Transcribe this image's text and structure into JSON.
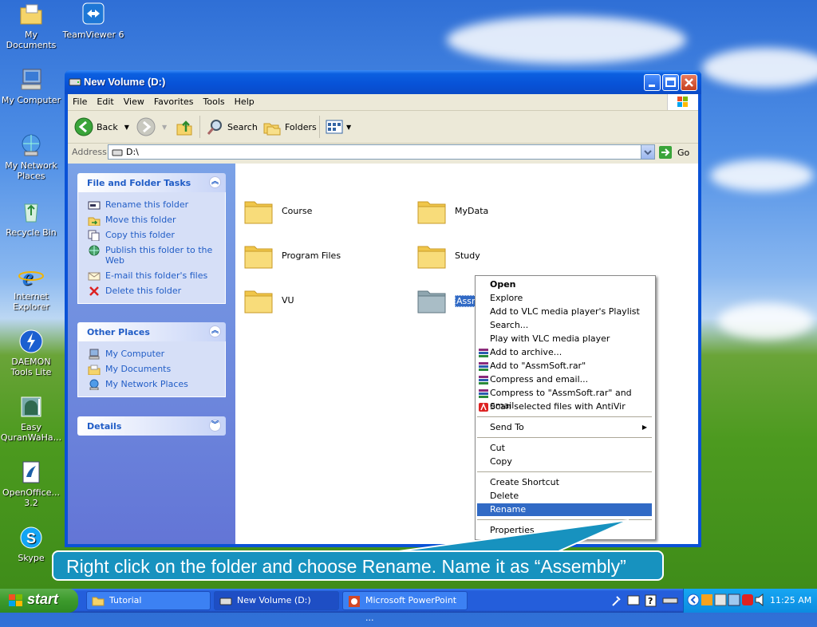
{
  "desktop": {
    "icons": [
      {
        "label": "My Documents"
      },
      {
        "label": "TeamViewer 6"
      },
      {
        "label": "My Computer"
      },
      {
        "label": "My Network Places"
      },
      {
        "label": "Recycle Bin"
      },
      {
        "label": "Internet Explorer"
      },
      {
        "label": "DAEMON Tools Lite"
      },
      {
        "label": "Easy QuranWaHa..."
      },
      {
        "label": "OpenOffice... 3.2"
      },
      {
        "label": "Skype"
      }
    ]
  },
  "window": {
    "title": "New Volume (D:)",
    "menu": [
      "File",
      "Edit",
      "View",
      "Favorites",
      "Tools",
      "Help"
    ],
    "toolbar": {
      "back": "Back",
      "search": "Search",
      "folders": "Folders"
    },
    "address": {
      "label": "Address",
      "value": "D:\\",
      "go": "Go"
    }
  },
  "tasks_panel": {
    "title": "File and Folder Tasks",
    "items": [
      "Rename this folder",
      "Move this folder",
      "Copy this folder",
      "Publish this folder to the Web",
      "E-mail this folder's files",
      "Delete this folder"
    ]
  },
  "places_panel": {
    "title": "Other Places",
    "items": [
      "My Computer",
      "My Documents",
      "My Network Places"
    ]
  },
  "details_panel": {
    "title": "Details"
  },
  "folders": [
    "Course",
    "MyData",
    "Program Files",
    "Study",
    "VU",
    "AssmSoft"
  ],
  "context_menu": {
    "items": [
      "Open",
      "Explore",
      "Add to VLC media player's Playlist",
      "Search...",
      "Play with VLC media player",
      "Add to archive...",
      "Add to \"AssmSoft.rar\"",
      "Compress and email...",
      "Compress to \"AssmSoft.rar\" and email",
      "Scan selected files with AntiVir",
      "Send To",
      "Cut",
      "Copy",
      "Create Shortcut",
      "Delete",
      "Rename",
      "Properties"
    ],
    "selected": "Rename"
  },
  "callout": "Right click on the folder and choose Rename. Name it as “Assembly”",
  "taskbar": {
    "start": "start",
    "tasks": [
      "Tutorial",
      "New Volume (D:)",
      "Microsoft PowerPoint ..."
    ],
    "clock": "11:25 AM"
  },
  "colors": {
    "selection": "#316ac5",
    "link": "#215dc6",
    "callout": "#1792bf",
    "titlebar": "#0752d7"
  }
}
